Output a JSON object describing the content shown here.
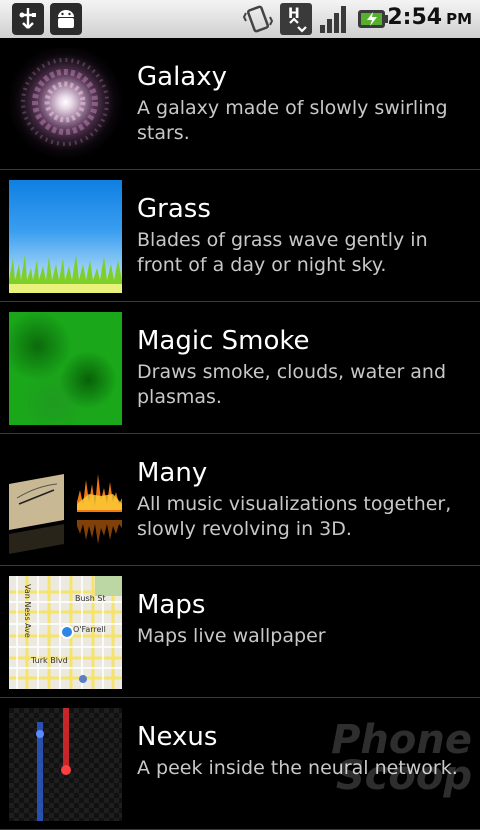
{
  "status_bar": {
    "time": "2:54",
    "ampm": "PM",
    "icons": [
      "usb-icon",
      "android-debug-icon",
      "vibrate-icon",
      "hsdpa-data-icon",
      "signal-strength-icon",
      "battery-charging-icon"
    ]
  },
  "wallpapers": [
    {
      "title": "Galaxy",
      "description": "A galaxy made of slowly swirling stars."
    },
    {
      "title": "Grass",
      "description": "Blades of grass wave gently in front of a day or night sky."
    },
    {
      "title": "Magic Smoke",
      "description": "Draws smoke, clouds, water and plasmas."
    },
    {
      "title": "Many",
      "description": "All music visualizations together, slowly revolving in 3D."
    },
    {
      "title": "Maps",
      "description": "Maps live wallpaper"
    },
    {
      "title": "Nexus",
      "description": "A peek inside the neural network."
    }
  ],
  "maps_thumb": {
    "streets": [
      "Bush St",
      "O'Farrell",
      "Turk Blvd",
      "Van Ness Ave"
    ]
  },
  "watermark": {
    "line1": "Phone",
    "line2": "Scoop"
  }
}
